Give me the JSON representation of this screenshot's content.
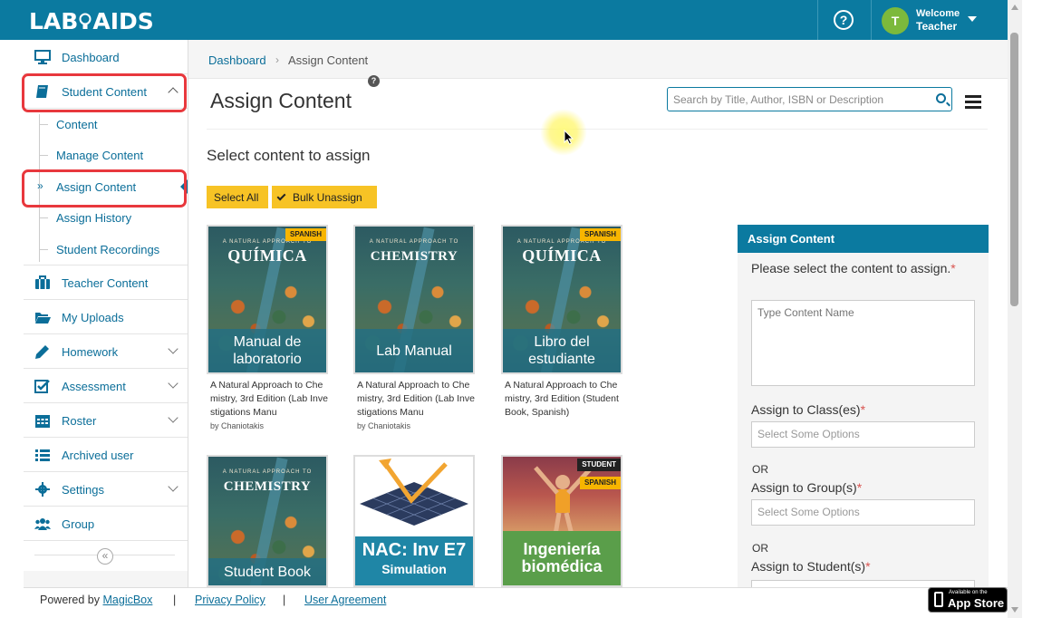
{
  "brand": {
    "logo_left": "LAB",
    "logo_right": "AIDS"
  },
  "header": {
    "help_icon": "question-circle-icon",
    "avatar_initial": "T",
    "welcome_label": "Welcome",
    "user_name": "Teacher"
  },
  "sidebar": {
    "items": [
      {
        "label": "Dashboard",
        "icon": "monitor-icon"
      },
      {
        "label": "Student Content",
        "icon": "book-icon",
        "expanded": true
      },
      {
        "label": "Teacher Content",
        "icon": "briefcase-icon"
      },
      {
        "label": "My Uploads",
        "icon": "folder-open-icon"
      },
      {
        "label": "Homework",
        "icon": "pencil-icon"
      },
      {
        "label": "Assessment",
        "icon": "checkbox-icon"
      },
      {
        "label": "Roster",
        "icon": "calendar-icon"
      },
      {
        "label": "Archived user",
        "icon": "list-icon"
      },
      {
        "label": "Settings",
        "icon": "gear-icon"
      },
      {
        "label": "Group",
        "icon": "users-icon"
      }
    ],
    "sub_items": [
      {
        "label": "Content"
      },
      {
        "label": "Manage Content"
      },
      {
        "label": "Assign Content",
        "active": true
      },
      {
        "label": "Assign History"
      },
      {
        "label": "Student Recordings"
      }
    ],
    "active_marker": "»",
    "collapse_glyph": "«"
  },
  "breadcrumb": {
    "home": "Dashboard",
    "separator": "›",
    "current": "Assign Content"
  },
  "page": {
    "title": "Assign Content",
    "help_glyph": "?",
    "search_placeholder": "Search by Title, Author, ISBN or Description",
    "section_title": "Select content to assign",
    "select_all": "Select All",
    "bulk_unassign": "Bulk Unassign"
  },
  "cards": [
    {
      "series": "A NATURAL APPROACH TO",
      "cover_title": "QUÍMICA",
      "band": "Manual de laboratorio",
      "tag": "SPANISH",
      "desc": "A Natural Approach to Chemistry, 3rd Edition (Lab Investigations Manu",
      "author": "by Chaniotakis"
    },
    {
      "series": "A NATURAL APPROACH TO",
      "cover_title": "CHEMISTRY",
      "band": "Lab Manual",
      "tag": "",
      "desc": "A Natural Approach to Chemistry, 3rd Edition (Lab Investigations Manu",
      "author": "by Chaniotakis"
    },
    {
      "series": "A NATURAL APPROACH TO",
      "cover_title": "QUÍMICA",
      "band": "Libro del estudiante",
      "tag": "SPANISH",
      "desc": "A Natural Approach to Chemistry, 3rd Edition (Student Book, Spanish)",
      "author": ""
    },
    {
      "series": "A NATURAL APPROACH TO",
      "cover_title": "CHEMISTRY",
      "band": "Student Book",
      "tag": "",
      "desc": "",
      "author": ""
    },
    {
      "band": "NAC: Inv E7",
      "band_sub": "Simulation"
    },
    {
      "band": "Ingeniería biomédica",
      "tag_top": "STUDENT",
      "tag": "SPANISH"
    }
  ],
  "assign_panel": {
    "heading": "Assign Content",
    "content_label": "Please select the content to assign.",
    "content_placeholder": "Type Content Name",
    "class_label": "Assign to Class(es)",
    "class_placeholder": "Select Some Options",
    "or1": "OR",
    "group_label": "Assign to Group(s)",
    "group_placeholder": "Select Some Options",
    "or2": "OR",
    "student_label": "Assign to Student(s)",
    "required_mark": "*"
  },
  "footer": {
    "powered_by": "Powered by",
    "powered_link": "MagicBox",
    "sep": "|",
    "privacy": "Privacy Policy",
    "agreement": "User Agreement",
    "appstore_small": "Available on the",
    "appstore_big": "App Store"
  },
  "colors": {
    "brand": "#0b7aa0",
    "accent": "#f7c325",
    "highlight": "#e8383d",
    "link": "#0b6e99"
  }
}
